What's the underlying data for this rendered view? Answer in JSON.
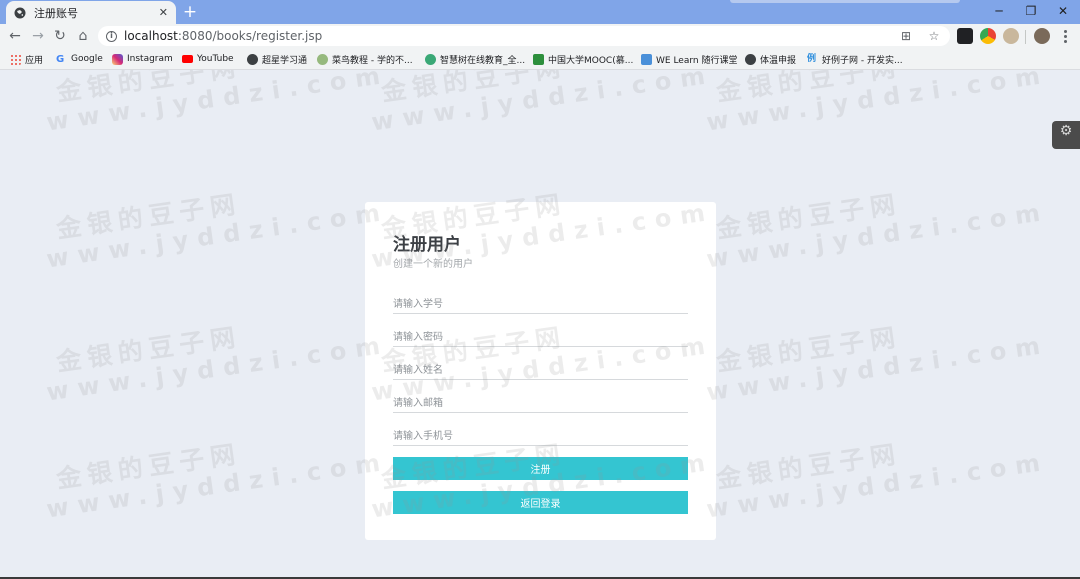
{
  "tab": {
    "title": "注册账号",
    "close": "✕"
  },
  "window_controls": {
    "minimize": "─",
    "restore": "❐",
    "close": "✕"
  },
  "address_bar": {
    "host": "localhost",
    "path": ":8080/books/register.jsp"
  },
  "bookmarks": [
    {
      "label": "应用",
      "icon": "apps-grid-icon",
      "color": "#ea4335"
    },
    {
      "label": "Google",
      "icon": "google-icon",
      "color": "#4285f4"
    },
    {
      "label": "Instagram",
      "icon": "instagram-icon",
      "color": "#d62976"
    },
    {
      "label": "YouTube",
      "icon": "youtube-icon",
      "color": "#ff0000"
    },
    {
      "label": "超星学习通",
      "icon": "globe-icon",
      "color": "#3c4043"
    },
    {
      "label": "菜鸟教程 - 学的不...",
      "icon": "runoob-icon",
      "color": "#96b97d"
    },
    {
      "label": "智慧树在线教育_全...",
      "icon": "zhihuishu-icon",
      "color": "#3aa876"
    },
    {
      "label": "中国大学MOOC(慕...",
      "icon": "mooc-icon",
      "color": "#2d8f3c"
    },
    {
      "label": "WE Learn 随行课堂",
      "icon": "welearn-icon",
      "color": "#4a90d9"
    },
    {
      "label": "体温申报",
      "icon": "globe-icon",
      "color": "#3c4043"
    },
    {
      "label": "好例子网 - 开发实...",
      "icon": "haolizi-icon",
      "color": "#2f8fdd"
    }
  ],
  "form": {
    "title": "注册用户",
    "subtitle": "创建一个新的用户",
    "fields": {
      "student_id": {
        "placeholder": "请输入学号"
      },
      "password": {
        "placeholder": "请输入密码"
      },
      "name": {
        "placeholder": "请输入姓名"
      },
      "email": {
        "placeholder": "请输入邮箱"
      },
      "phone": {
        "placeholder": "请输入手机号"
      }
    },
    "register_label": "注册",
    "back_label": "返回登录"
  },
  "watermark": {
    "line1": "金银的豆子网",
    "line2": "www.jyddzi.com"
  },
  "colors": {
    "accent": "#34c5d1",
    "titlebar": "#80a5e8",
    "page_bg": "#e9edf4"
  }
}
